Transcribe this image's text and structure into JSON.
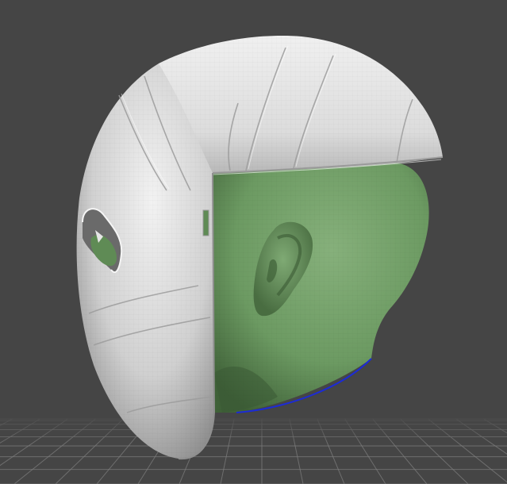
{
  "viewport": {
    "background_color": "#454545",
    "grid_color": "#7c7c7c"
  },
  "model": {
    "helmet_color": "#d9d9d9",
    "helmet_shadow_color": "#8a8a8a",
    "head_color": "#6c9a62",
    "head_shadow_color": "#3a5a34",
    "selection_edge_color": "#1c2bd6"
  }
}
